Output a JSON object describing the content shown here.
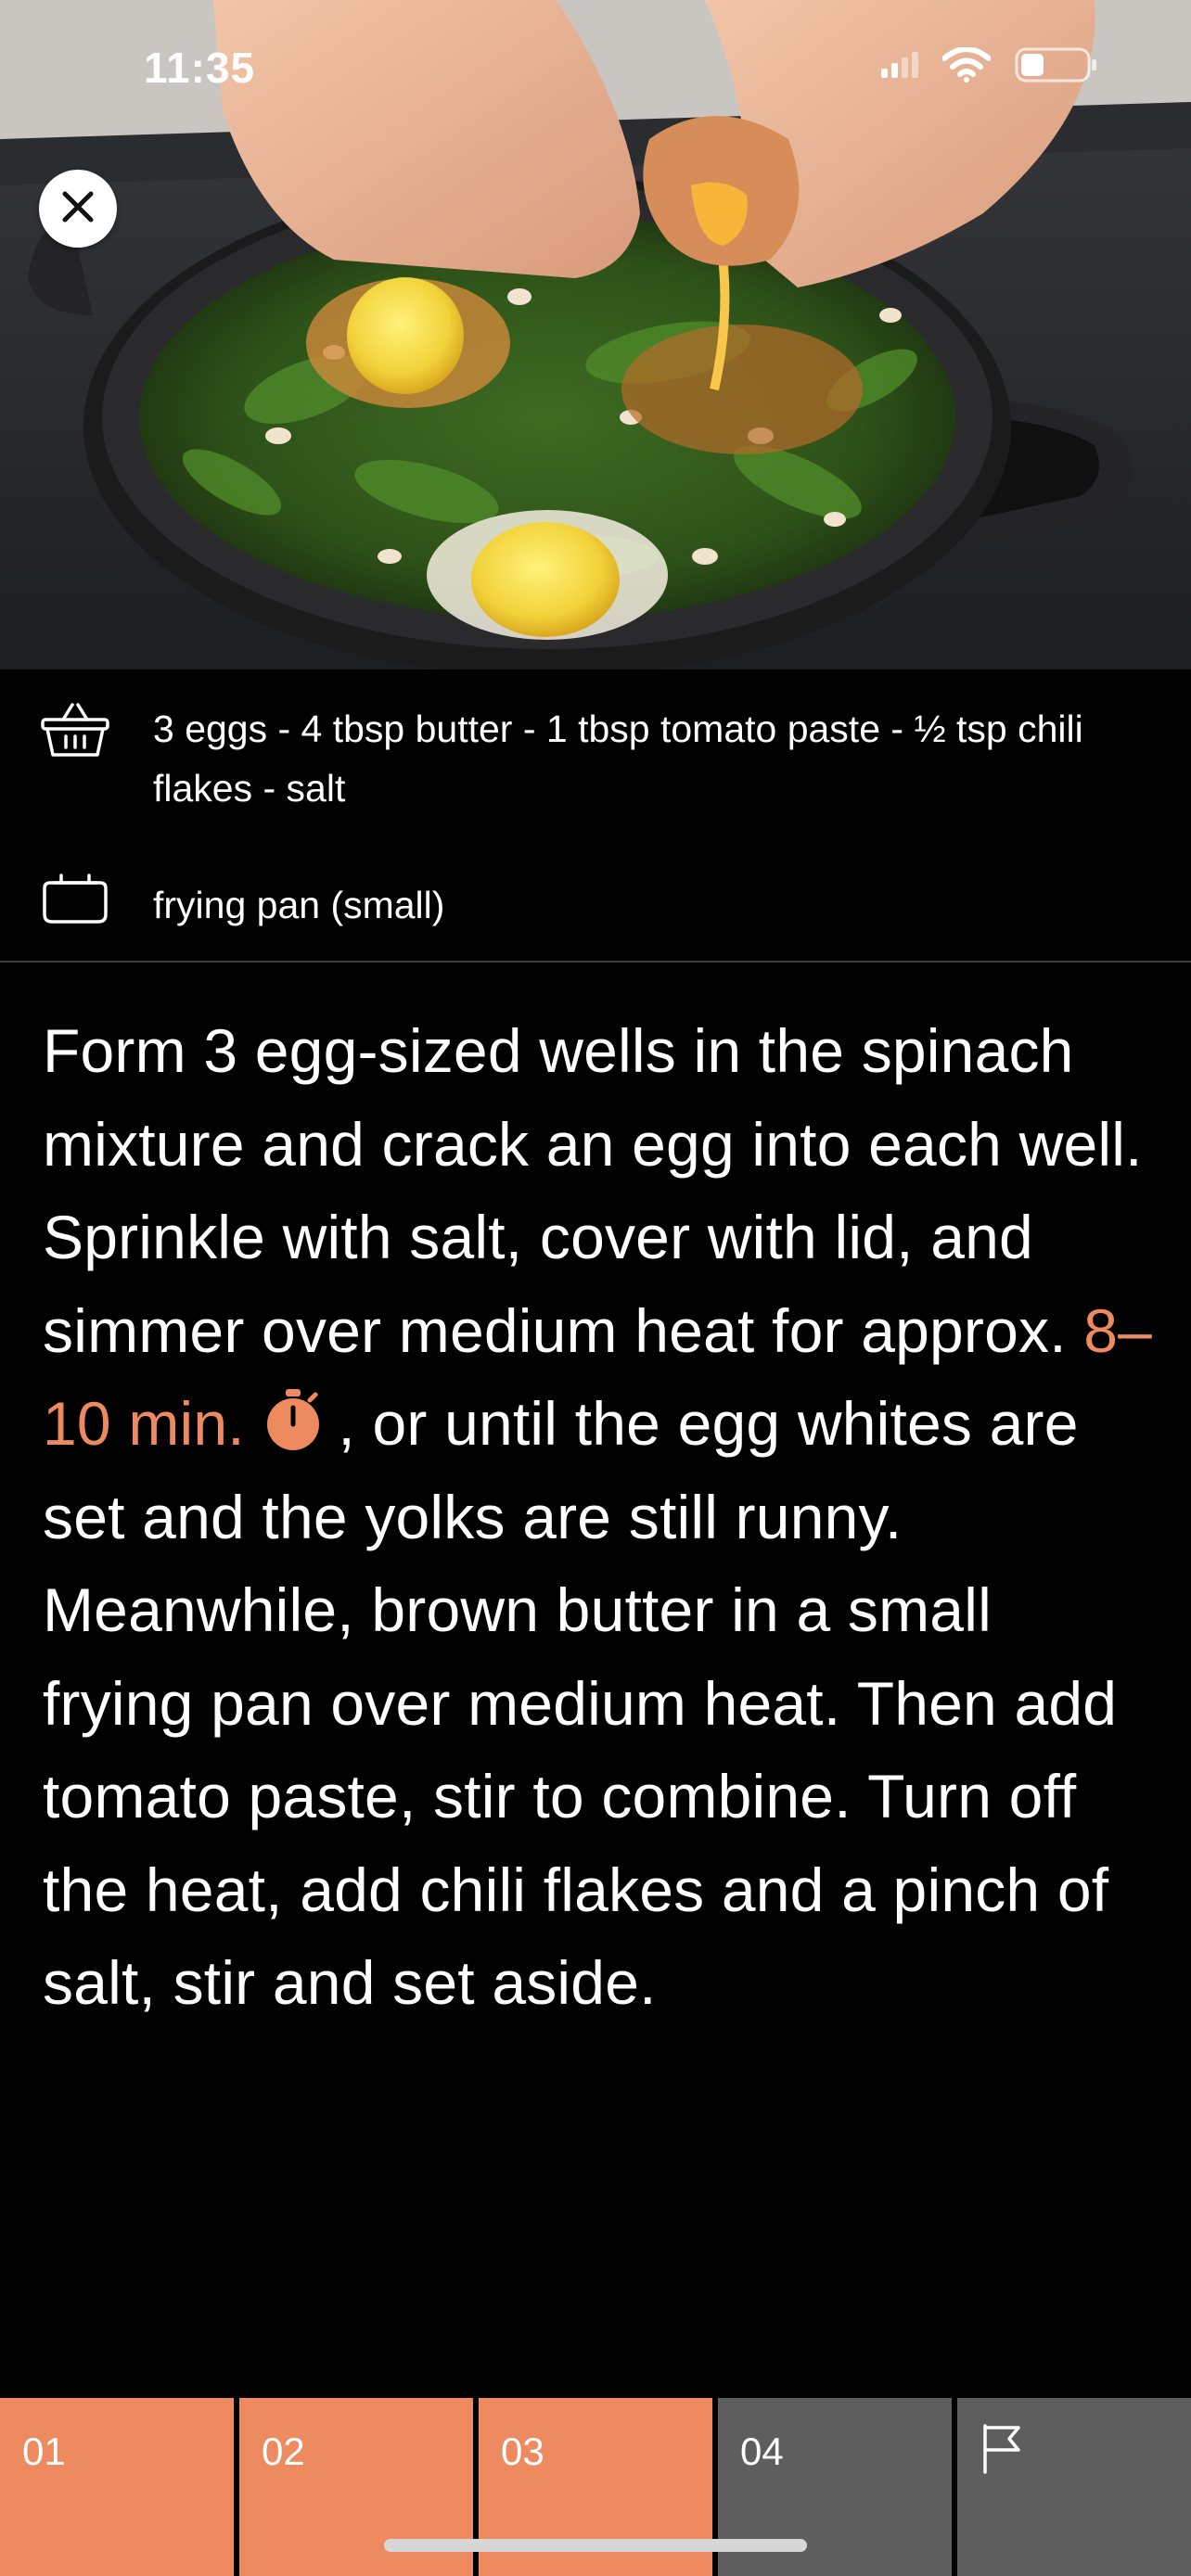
{
  "status_bar": {
    "time": "11:35",
    "icons": [
      "cellular-signal-icon",
      "wifi-icon",
      "battery-icon"
    ]
  },
  "hero": {
    "image": "eggs-cracked-into-spinach-in-cast-iron-pan",
    "close_icon": "close-icon"
  },
  "ingredients": {
    "icon": "basket-icon",
    "text": "3 eggs - 4 tbsp butter - 1 tbsp tomato paste - ½ tsp chili flakes - salt"
  },
  "utensils": {
    "icon": "pot-icon",
    "text": "frying pan (small)"
  },
  "instruction": {
    "before_timer": "Form 3 egg-sized wells in the spinach mixture and crack an egg into each well. Sprinkle with salt, cover with lid, and simmer over medium heat for approx. ",
    "timer_text": "8–10 min.",
    "timer_icon": "stopwatch-icon",
    "after_timer": ", or until the egg whites are set and the yolks are still runny. Meanwhile, brown butter in a small frying pan over medium heat. Then add tomato paste, stir to combine. Turn off the heat, add chili flakes and a pinch of salt, stir and set aside."
  },
  "steps": [
    {
      "label": "01",
      "state": "done"
    },
    {
      "label": "02",
      "state": "done"
    },
    {
      "label": "03",
      "state": "current"
    },
    {
      "label": "04",
      "state": "pending"
    },
    {
      "label": "",
      "icon": "flag-icon",
      "state": "pending"
    }
  ],
  "colors": {
    "accent": "#ee8a5f",
    "pending": "#5e5e5e",
    "background": "#000000",
    "text": "#ffffff"
  }
}
